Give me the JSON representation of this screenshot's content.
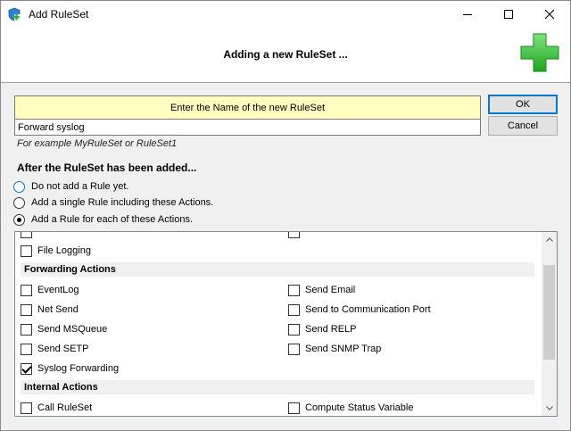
{
  "window": {
    "title": "Add RuleSet"
  },
  "header": {
    "title": "Adding a new RuleSet ..."
  },
  "name_box": {
    "label": "Enter the Name of the new RuleSet",
    "value": "Forward syslog",
    "example": "For example MyRuleSet or RuleSet1"
  },
  "buttons": {
    "ok": "OK",
    "cancel": "Cancel"
  },
  "after": {
    "label": "After the RuleSet has been added...",
    "options": [
      {
        "label": "Do not add a Rule yet.",
        "selected": false
      },
      {
        "label": "Add a single Rule including these Actions.",
        "selected": false
      },
      {
        "label": "Add a Rule for each of these Actions.",
        "selected": true
      }
    ]
  },
  "actions": {
    "file_logging": "File Logging",
    "forwarding_header": "Forwarding Actions",
    "forwarding": [
      {
        "label": "EventLog",
        "checked": false
      },
      {
        "label": "Send Email",
        "checked": false
      },
      {
        "label": "Net Send",
        "checked": false
      },
      {
        "label": "Send to Communication Port",
        "checked": false
      },
      {
        "label": "Send MSQueue",
        "checked": false
      },
      {
        "label": "Send RELP",
        "checked": false
      },
      {
        "label": "Send SETP",
        "checked": false
      },
      {
        "label": "Send SNMP Trap",
        "checked": false
      },
      {
        "label": "Syslog Forwarding",
        "checked": true
      }
    ],
    "internal_header": "Internal Actions",
    "internal": [
      {
        "label": "Call RuleSet",
        "checked": false
      },
      {
        "label": "Compute Status Variable",
        "checked": false
      }
    ]
  },
  "colors": {
    "accent": "#0078d7",
    "name_label_bg": "#ffffc0",
    "plus_green": "#3cc43c"
  }
}
